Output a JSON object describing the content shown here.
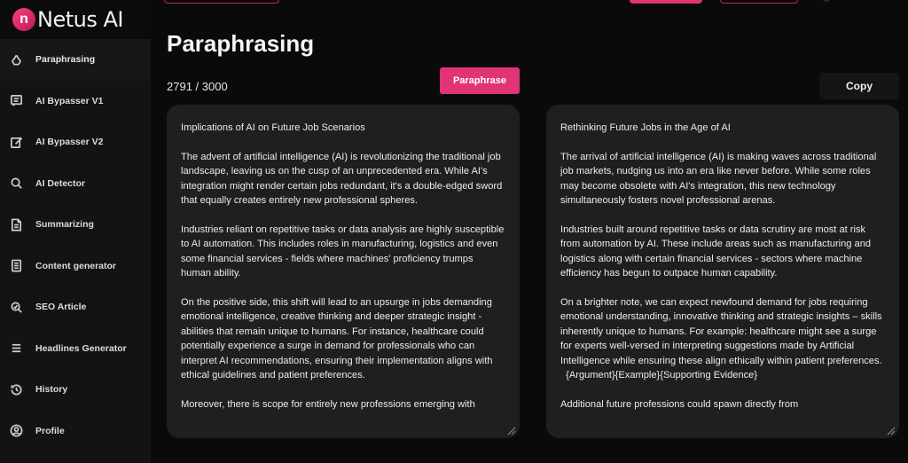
{
  "brand": {
    "name": "Netus AI",
    "logo_letter": "n"
  },
  "sidebar": {
    "items": [
      {
        "label": "Paraphrasing",
        "icon": "recycle-icon",
        "active": true
      },
      {
        "label": "AI Bypasser V1",
        "icon": "message-icon"
      },
      {
        "label": "AI Bypasser V2",
        "icon": "edit-icon"
      },
      {
        "label": "AI Detector",
        "icon": "search-icon"
      },
      {
        "label": "Summarizing",
        "icon": "document-icon"
      },
      {
        "label": "Content generator",
        "icon": "list-document-icon"
      },
      {
        "label": "SEO Article",
        "icon": "seo-search-icon"
      },
      {
        "label": "Headlines Generator",
        "icon": "menu-lines-icon"
      },
      {
        "label": "History",
        "icon": "history-icon"
      },
      {
        "label": "Profile",
        "icon": "user-icon"
      }
    ]
  },
  "main": {
    "title": "Paraphrasing",
    "counter": "2791 / 3000",
    "paraphrase_label": "Paraphrase",
    "copy_label": "Copy",
    "input_text": "Implications of AI on Future Job Scenarios\n\nThe advent of artificial intelligence (AI) is revolutionizing the traditional job landscape, leaving us on the cusp of an unprecedented era. While AI's integration might render certain jobs redundant, it's a double-edged sword that equally creates entirely new professional spheres.\n\nIndustries reliant on repetitive tasks or data analysis are highly susceptible to AI automation. This includes roles in manufacturing, logistics and even some financial services - fields where machines' proficiency trumps human ability.\n\nOn the positive side, this shift will lead to an upsurge in jobs demanding emotional intelligence, creative thinking and deeper strategic insight - abilities that remain unique to humans. For instance, healthcare could potentially experience a surge in demand for professionals who can interpret AI recommendations, ensuring their implementation aligns with ethical guidelines and patient preferences.\n\nMoreover, there is scope for entirely new professions emerging with",
    "output_text": "Rethinking Future Jobs in the Age of AI\n\nThe arrival of artificial intelligence (AI) is making waves across traditional job markets, nudging us into an era like never before. While some roles may become obsolete with AI's integration, this new technology simultaneously fosters novel professional arenas.\n\nIndustries built around repetitive tasks or data scrutiny are most at risk from automation by AI. These include areas such as manufacturing and logistics along with certain financial services - sectors where machine efficiency has begun to outpace human capability.\n\nOn a brighter note, we can expect newfound demand for jobs requiring emotional understanding, innovative thinking and strategic insights – skills inherently unique to humans. For example: healthcare might see a surge for experts well-versed in interpreting suggestions made by Artificial Intelligence while ensuring these align ethically within patient preferences.\n  {Argument}{Example}{Supporting Evidence}\n\nAdditional future professions could spawn directly from"
  },
  "colors": {
    "accent": "#e03476",
    "panel": "#1f1f1f",
    "sidebar": "#131313",
    "background": "#0a0a0a"
  }
}
